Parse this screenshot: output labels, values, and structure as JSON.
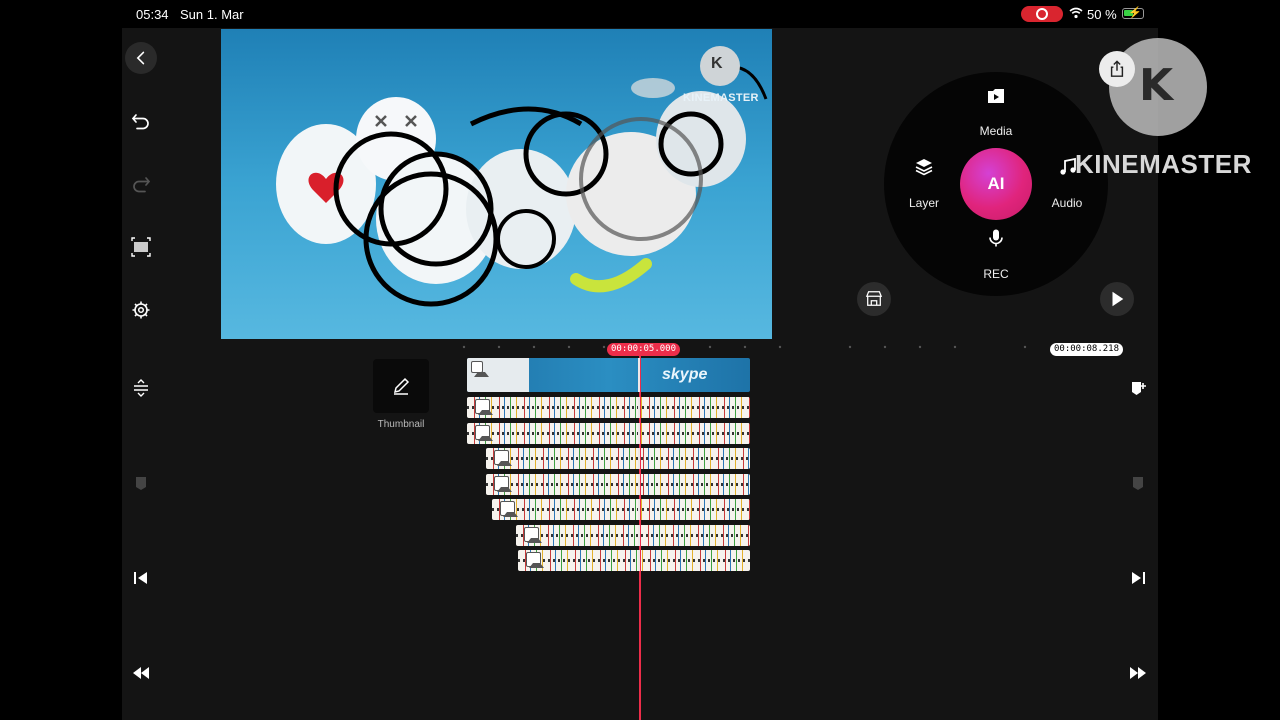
{
  "status_bar": {
    "time": "05:34",
    "date": "Sun 1. Mar",
    "battery": "50 %",
    "battery_level": 0.5
  },
  "preview": {
    "watermark": "KINEMASTER",
    "watermark_letter": "K"
  },
  "wheel": {
    "media_label": "Media",
    "layer_label": "Layer",
    "audio_label": "Audio",
    "rec_label": "REC",
    "ai_label": "AI"
  },
  "logo": {
    "letter": "K",
    "text": "KINEMASTER"
  },
  "timeline": {
    "current_time": "00:00:05.000",
    "total_time": "00:00:08.218",
    "thumbnail_label": "Thumbnail",
    "main_clip_text": "skype"
  },
  "colors": {
    "accent": "#ed2d4a",
    "ai_gradient_start": "#d441d4",
    "ai_gradient_end": "#e0247c",
    "panel_bg": "#141414"
  }
}
